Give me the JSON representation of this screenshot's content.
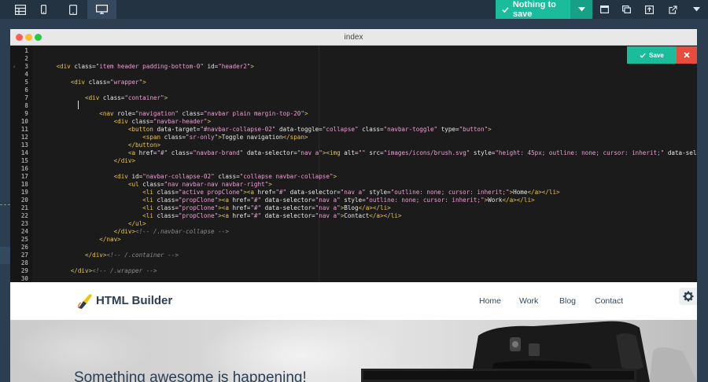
{
  "toolbar": {
    "save_label": "Nothing to save",
    "icons": [
      "grid-view-icon",
      "phone-view-icon",
      "tablet-view-icon",
      "desktop-view-icon",
      "preview-icon",
      "duplicate-icon",
      "export-icon",
      "open-external-icon",
      "menu-caret-icon"
    ]
  },
  "editor": {
    "title": "index",
    "save_label": "Save",
    "close_icon": "close-icon",
    "lines": [
      {
        "n": "1",
        "html": ""
      },
      {
        "n": "2",
        "html": ""
      },
      {
        "n": "3",
        "html": "      <span class=\"t\">&lt;div</span> <span class=\"a\">class</span>=<span class=\"s\">\"item header padding-bottom-0\"</span> <span class=\"a\">id</span>=<span class=\"s\">\"header2\"</span><span class=\"t\">&gt;</span>"
      },
      {
        "n": "4",
        "html": ""
      },
      {
        "n": "5",
        "html": "          <span class=\"t\">&lt;div</span> <span class=\"a\">class</span>=<span class=\"s\">\"wrapper\"</span><span class=\"t\">&gt;</span>"
      },
      {
        "n": "6",
        "html": ""
      },
      {
        "n": "7",
        "html": "              <span class=\"t\">&lt;div</span> <span class=\"a\">class</span>=<span class=\"s\">\"container\"</span><span class=\"t\">&gt;</span>"
      },
      {
        "n": "8",
        "html": ""
      },
      {
        "n": "9",
        "html": "                  <span class=\"t\">&lt;nav</span> <span class=\"a\">role</span>=<span class=\"s\">\"navigation\"</span> <span class=\"a\">class</span>=<span class=\"s\">\"navbar plain margin-top-20\"</span><span class=\"t\">&gt;</span>"
      },
      {
        "n": "10",
        "html": "                      <span class=\"t\">&lt;div</span> <span class=\"a\">class</span>=<span class=\"s\">\"navbar-header\"</span><span class=\"t\">&gt;</span>"
      },
      {
        "n": "11",
        "html": "                          <span class=\"t\">&lt;button</span> <span class=\"a\">data-target</span>=<span class=\"s\">\"#navbar-collapse-02\"</span> <span class=\"a\">data-toggle</span>=<span class=\"s\">\"collapse\"</span> <span class=\"a\">class</span>=<span class=\"s\">\"navbar-toggle\"</span> <span class=\"a\">type</span>=<span class=\"s\">\"button\"</span><span class=\"t\">&gt;</span>"
      },
      {
        "n": "12",
        "html": "                              <span class=\"t\">&lt;span</span> <span class=\"a\">class</span>=<span class=\"s\">\"sr-only\"</span><span class=\"t\">&gt;</span>Toggle navigation<span class=\"t\">&lt;/span&gt;</span>"
      },
      {
        "n": "13",
        "html": "                          <span class=\"t\">&lt;/button&gt;</span>"
      },
      {
        "n": "14",
        "html": "                          <span class=\"t\">&lt;a</span> <span class=\"a\">href</span>=<span class=\"s\">\"#\"</span> <span class=\"a\">class</span>=<span class=\"s\">\"navbar-brand\"</span> <span class=\"a\">data-selector</span>=<span class=\"s\">\"nav a\"</span><span class=\"t\">&gt;&lt;img</span> <span class=\"a\">alt</span>=<span class=\"s\">\"\"</span> <span class=\"a\">src</span>=<span class=\"s\">\"images/icons/brush.svg\"</span> <span class=\"a\">style</span>=<span class=\"s\">\"height: 45px; outline: none; cursor: inherit;\"</span> <span class=\"a\">data-sele</span>"
      },
      {
        "n": "15",
        "html": "                      <span class=\"t\">&lt;/div&gt;</span>"
      },
      {
        "n": "16",
        "html": ""
      },
      {
        "n": "17",
        "html": "                      <span class=\"t\">&lt;div</span> <span class=\"a\">id</span>=<span class=\"s\">\"navbar-collapse-02\"</span> <span class=\"a\">class</span>=<span class=\"s\">\"collapse navbar-collapse\"</span><span class=\"t\">&gt;</span>"
      },
      {
        "n": "18",
        "html": "                          <span class=\"t\">&lt;ul</span> <span class=\"a\">class</span>=<span class=\"s\">\"nav navbar-nav navbar-right\"</span><span class=\"t\">&gt;</span>"
      },
      {
        "n": "19",
        "html": "                              <span class=\"t\">&lt;li</span> <span class=\"a\">class</span>=<span class=\"s\">\"active propClone\"</span><span class=\"t\">&gt;&lt;a</span> <span class=\"a\">href</span>=<span class=\"s\">\"#\"</span> <span class=\"a\">data-selector</span>=<span class=\"s\">\"nav a\"</span> <span class=\"a\">style</span>=<span class=\"s\">\"outline: none; cursor: inherit;\"</span><span class=\"t\">&gt;</span>Home<span class=\"t\">&lt;/a&gt;&lt;/li&gt;</span>"
      },
      {
        "n": "20",
        "html": "                              <span class=\"t\">&lt;li</span> <span class=\"a\">class</span>=<span class=\"s\">\"propClone\"</span><span class=\"t\">&gt;&lt;a</span> <span class=\"a\">href</span>=<span class=\"s\">\"#\"</span> <span class=\"a\">data-selector</span>=<span class=\"s\">\"nav a\"</span> <span class=\"a\">style</span>=<span class=\"s\">\"outline: none; cursor: inherit;\"</span><span class=\"t\">&gt;</span>Work<span class=\"t\">&lt;/a&gt;&lt;/li&gt;</span>"
      },
      {
        "n": "21",
        "html": "                              <span class=\"t\">&lt;li</span> <span class=\"a\">class</span>=<span class=\"s\">\"propClone\"</span><span class=\"t\">&gt;&lt;a</span> <span class=\"a\">href</span>=<span class=\"s\">\"#\"</span> <span class=\"a\">data-selector</span>=<span class=\"s\">\"nav a\"</span><span class=\"t\">&gt;</span>Blog<span class=\"t\">&lt;/a&gt;&lt;/li&gt;</span>"
      },
      {
        "n": "22",
        "html": "                              <span class=\"t\">&lt;li</span> <span class=\"a\">class</span>=<span class=\"s\">\"propClone\"</span><span class=\"t\">&gt;&lt;a</span> <span class=\"a\">href</span>=<span class=\"s\">\"#\"</span> <span class=\"a\">data-selector</span>=<span class=\"s\">\"nav a\"</span><span class=\"t\">&gt;</span>Contact<span class=\"t\">&lt;/a&gt;&lt;/li&gt;</span>"
      },
      {
        "n": "23",
        "html": "                          <span class=\"t\">&lt;/ul&gt;</span>"
      },
      {
        "n": "24",
        "html": "                      <span class=\"t\">&lt;/div&gt;</span><span class=\"c\">&lt;!-- /.navbar-collapse --&gt;</span>"
      },
      {
        "n": "25",
        "html": "                  <span class=\"t\">&lt;/nav&gt;</span>"
      },
      {
        "n": "26",
        "html": ""
      },
      {
        "n": "27",
        "html": "              <span class=\"t\">&lt;/div&gt;</span><span class=\"c\">&lt;!-- /.container --&gt;</span>"
      },
      {
        "n": "28",
        "html": ""
      },
      {
        "n": "29",
        "html": "          <span class=\"t\">&lt;/div&gt;</span><span class=\"c\">&lt;!-- /.wrapper --&gt;</span>"
      },
      {
        "n": "30",
        "html": ""
      }
    ]
  },
  "preview": {
    "brand": "HTML Builder",
    "nav": [
      "Home",
      "Work",
      "Blog",
      "Contact"
    ],
    "hero_title": "Something awesome is happening!",
    "settings_icon": "gear-icon"
  },
  "colors": {
    "accent": "#1abc9c",
    "accent_dark": "#16a085",
    "danger": "#e74c3c",
    "chrome": "#2c3e50",
    "editor_bg": "#1b1b1b"
  }
}
